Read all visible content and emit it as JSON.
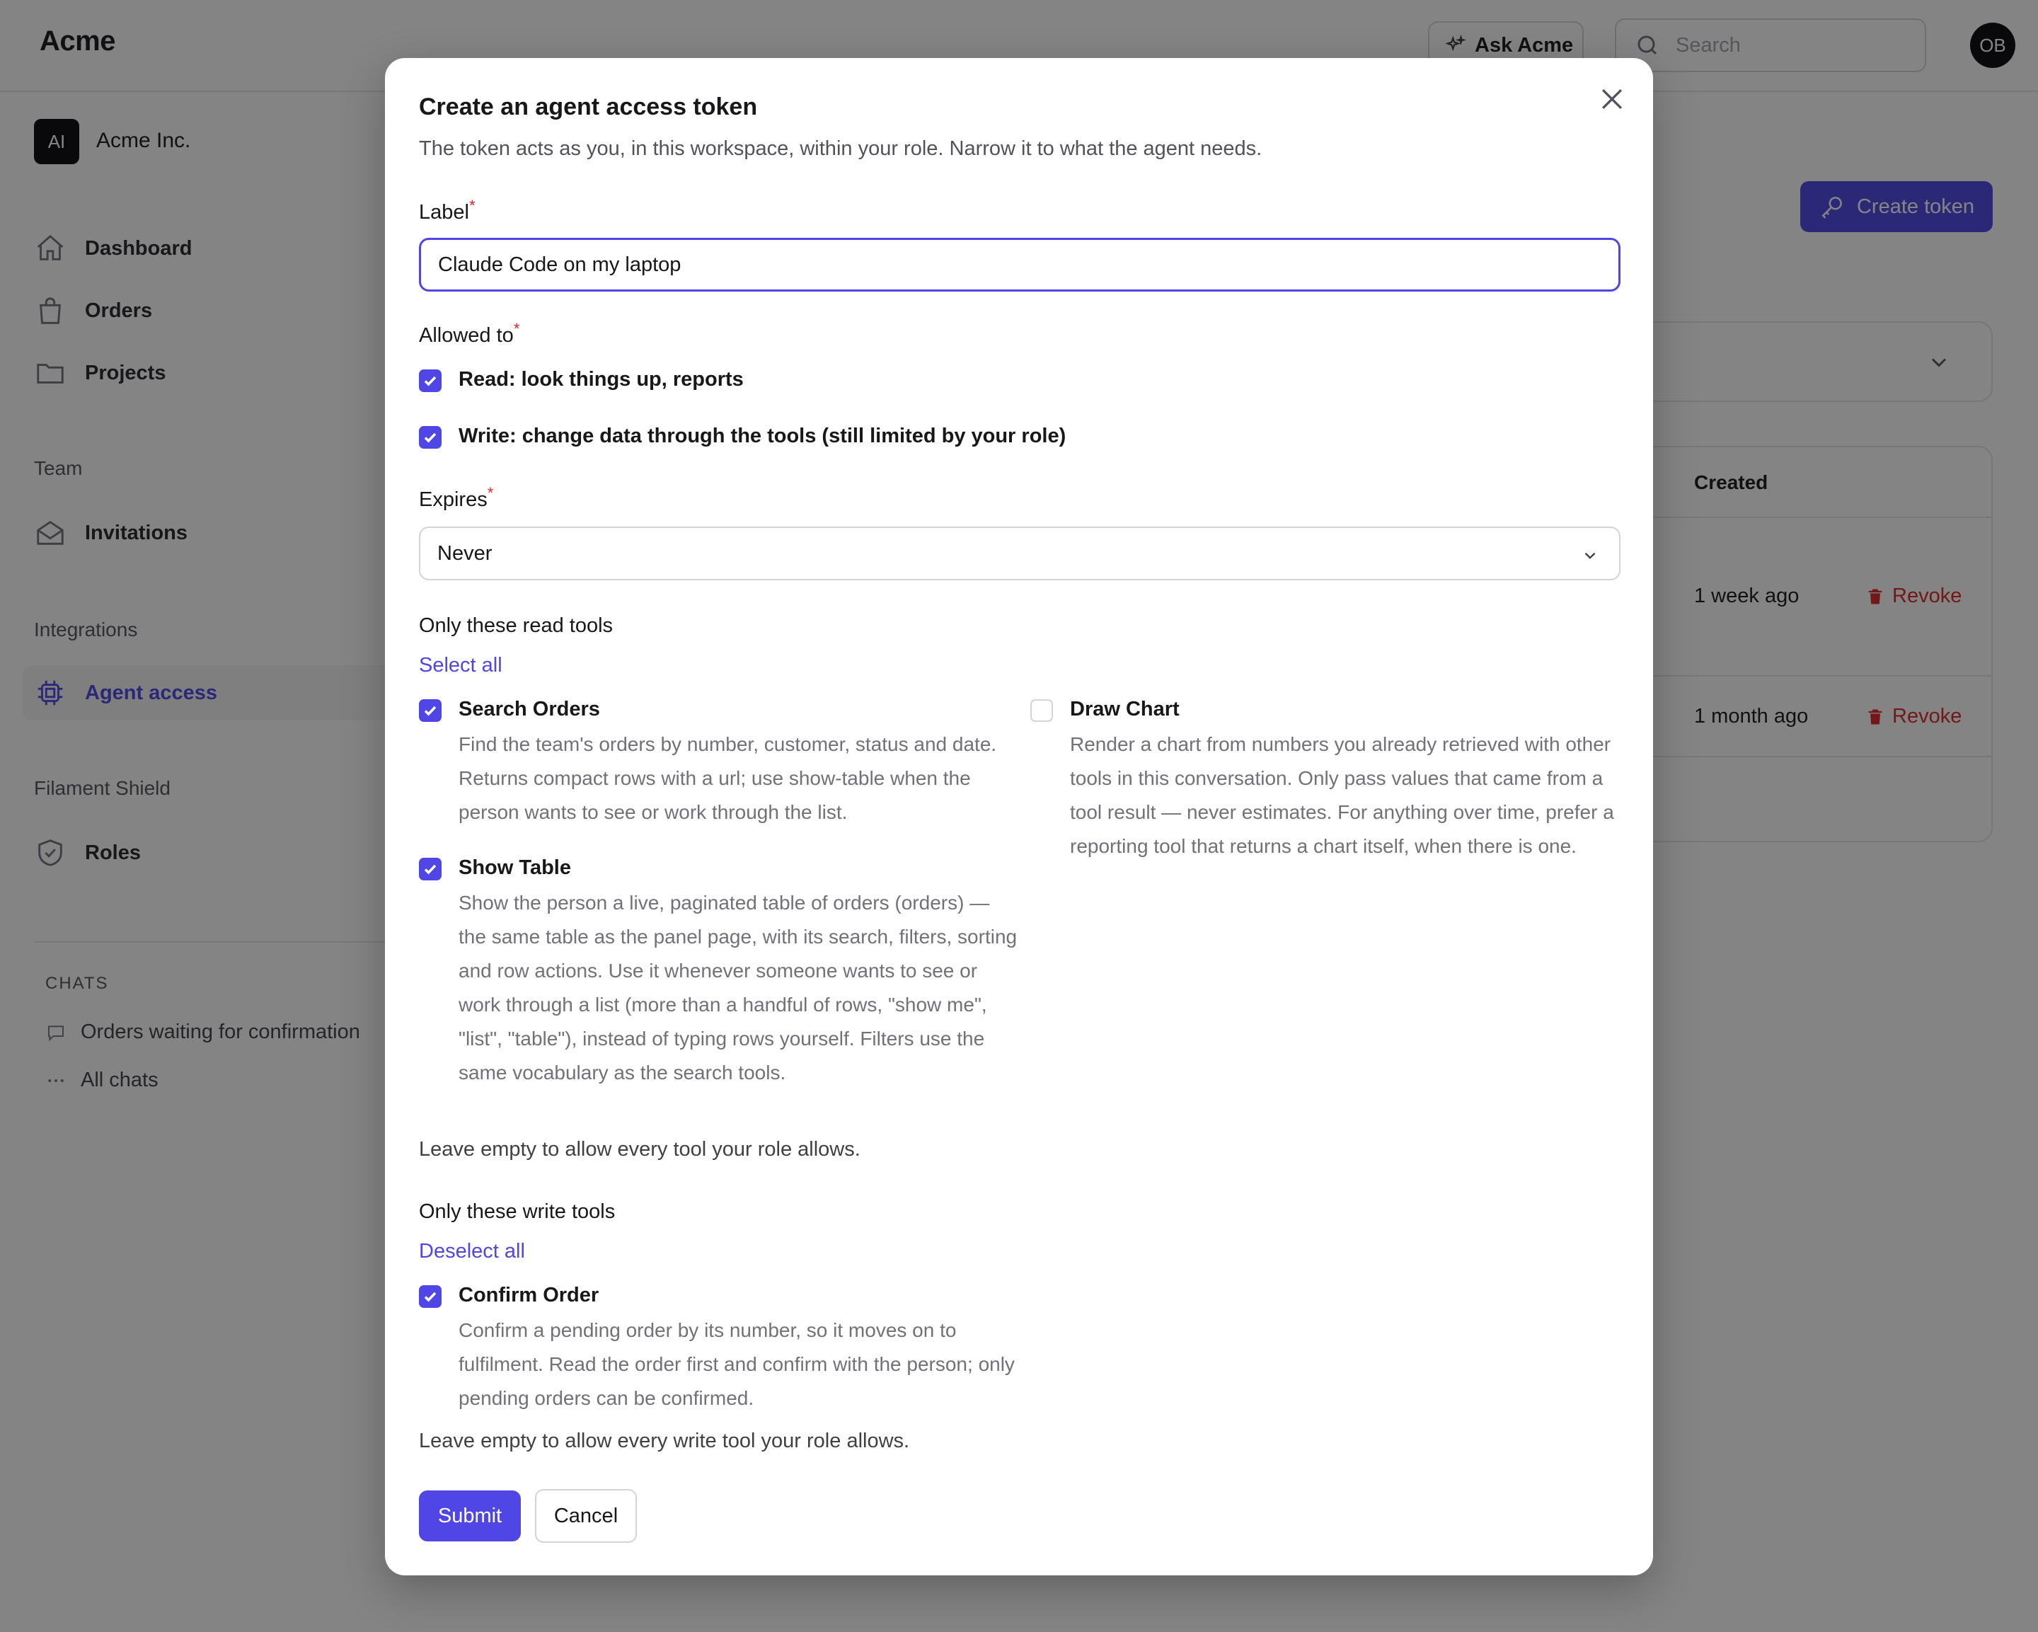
{
  "app": {
    "brand": "Acme",
    "user_initials": "OB"
  },
  "topbar": {
    "ask_label": "Ask Acme",
    "search_placeholder": "Search"
  },
  "sidebar": {
    "workspace_initials": "AI",
    "workspace_name": "Acme Inc.",
    "items": [
      {
        "label": "Dashboard",
        "icon": "home-icon"
      },
      {
        "label": "Orders",
        "icon": "shopping-bag-icon"
      },
      {
        "label": "Projects",
        "icon": "folder-icon"
      }
    ],
    "groups": {
      "team": {
        "label": "Team",
        "items": [
          {
            "label": "Invitations",
            "icon": "envelope-open-icon"
          }
        ]
      },
      "integrations": {
        "label": "Integrations",
        "items": [
          {
            "label": "Agent access",
            "icon": "cpu-chip-icon",
            "active": true
          }
        ]
      },
      "shield": {
        "label": "Filament Shield",
        "items": [
          {
            "label": "Roles",
            "icon": "shield-check-icon"
          }
        ]
      }
    },
    "chats": {
      "heading": "CHATS",
      "items": [
        {
          "label": "Orders waiting for confirmation",
          "icon": "chat-bubble-icon"
        },
        {
          "label": "All chats",
          "icon": "ellipsis-icon"
        }
      ]
    }
  },
  "main": {
    "create_token_label": "Create token",
    "table": {
      "created_header": "Created",
      "rows": [
        {
          "created": "1 week ago",
          "action": "Revoke"
        },
        {
          "created": "1 month ago",
          "action": "Revoke"
        }
      ]
    }
  },
  "modal": {
    "title": "Create an agent access token",
    "description": "The token acts as you, in this workspace, within your role. Narrow it to what the agent needs.",
    "label_field": {
      "label": "Label",
      "required": "*",
      "value": "Claude Code on my laptop"
    },
    "allowed": {
      "label": "Allowed to",
      "required": "*",
      "options": [
        {
          "label": "Read: look things up, reports",
          "checked": true
        },
        {
          "label": "Write: change data through the tools (still limited by your role)",
          "checked": true
        }
      ]
    },
    "expires": {
      "label": "Expires",
      "required": "*",
      "value": "Never"
    },
    "read_tools": {
      "heading": "Only these read tools",
      "toggle_label": "Select all",
      "tools": [
        {
          "name": "Search Orders",
          "checked": true,
          "description": "Find the team's orders by number, customer, status and date. Returns compact rows with a url; use show-table when the person wants to see or work through the list."
        },
        {
          "name": "Show Table",
          "checked": true,
          "description": "Show the person a live, paginated table of orders (orders) — the same table as the panel page, with its search, filters, sorting and row actions. Use it whenever someone wants to see or work through a list (more than a handful of rows, \"show me\", \"list\", \"table\"), instead of typing rows yourself. Filters use the same vocabulary as the search tools."
        },
        {
          "name": "Draw Chart",
          "checked": false,
          "description": "Render a chart from numbers you already retrieved with other tools in this conversation. Only pass values that came from a tool result — never estimates. For anything over time, prefer a reporting tool that returns a chart itself, when there is one."
        }
      ],
      "hint": "Leave empty to allow every tool your role allows."
    },
    "write_tools": {
      "heading": "Only these write tools",
      "toggle_label": "Deselect all",
      "tools": [
        {
          "name": "Confirm Order",
          "checked": true,
          "description": "Confirm a pending order by its number, so it moves on to fulfilment. Read the order first and confirm with the person; only pending orders can be confirmed."
        }
      ],
      "hint": "Leave empty to allow every write tool your role allows."
    },
    "submit_label": "Submit",
    "cancel_label": "Cancel"
  },
  "colors": {
    "accent": "#4f46e5",
    "danger": "#dc2626",
    "backdrop": "rgba(9,9,11,0.5)"
  }
}
